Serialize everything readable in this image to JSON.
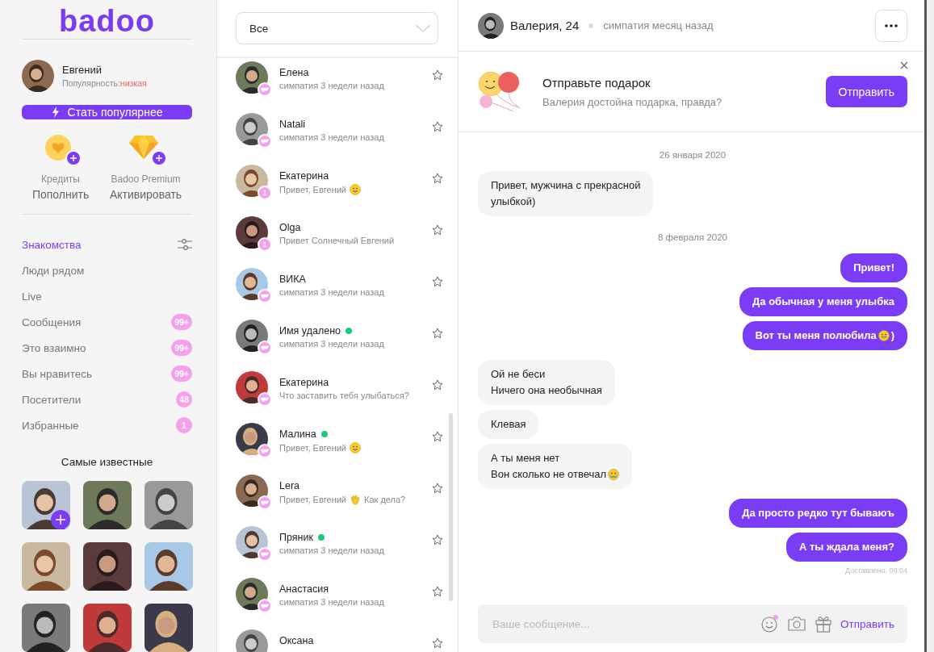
{
  "logo": "badoo",
  "profile": {
    "name": "Евгений",
    "popularity_label": "Популярность:",
    "popularity_value": "низкая"
  },
  "boost_button": "Стать популярнее",
  "perks": [
    {
      "kind": "credits",
      "title": "Кредиты",
      "action": "Пополнить"
    },
    {
      "kind": "premium",
      "title": "Badoo Premium",
      "action": "Активировать"
    }
  ],
  "nav": [
    {
      "label": "Знакомства",
      "selected": true,
      "filter": true
    },
    {
      "label": "Люди рядом",
      "selected": false,
      "filter": false
    },
    {
      "label": "Live",
      "selected": false,
      "filter": false
    },
    {
      "label": "Сообщения",
      "selected": false,
      "filter": false,
      "badge": "99+"
    },
    {
      "label": "Это взаимно",
      "selected": false,
      "filter": false,
      "badge": "99+"
    },
    {
      "label": "Вы нравитесь",
      "selected": false,
      "filter": false,
      "badge": "99+"
    },
    {
      "label": "Посетители",
      "selected": false,
      "filter": false,
      "badge": "48"
    },
    {
      "label": "Избранные",
      "selected": false,
      "filter": false,
      "badge": "1"
    }
  ],
  "popular": {
    "title": "Самые известные",
    "tiles": [
      {
        "kind": "picture",
        "add": true
      },
      {
        "kind": "picture",
        "add": false
      },
      {
        "kind": "picture",
        "add": false
      },
      {
        "kind": "picture",
        "add": false
      },
      {
        "kind": "picture",
        "add": false
      },
      {
        "kind": "picture",
        "add": false
      },
      {
        "kind": "picture",
        "add": false
      },
      {
        "kind": "picture",
        "add": false
      },
      {
        "kind": "picture",
        "add": false
      }
    ]
  },
  "filter_select": {
    "value": "Все"
  },
  "conversations": [
    {
      "name": "Елена",
      "preview": "симпатия 3 недели назад",
      "badge": {
        "kind": "like"
      },
      "online": false
    },
    {
      "name": "Natali",
      "preview": "симпатия 3 недели назад",
      "badge": {
        "kind": "like"
      },
      "online": false
    },
    {
      "name": "Екатерина",
      "preview": "Привет, Евгений",
      "emoji": {
        "kind": "smile"
      },
      "badge": {
        "kind": "count",
        "text": "1"
      },
      "online": false
    },
    {
      "name": "Olga",
      "preview": "Привет Солнечный Евгений",
      "badge": {
        "kind": "count",
        "text": "1"
      },
      "online": false
    },
    {
      "name": "ВИКА",
      "preview": "симпатия 3 недели назад",
      "badge": {
        "kind": "like"
      },
      "online": false
    },
    {
      "name": "Имя удалено",
      "preview": "симпатия 3 недели назад",
      "badge": {
        "kind": "like"
      },
      "online": true
    },
    {
      "name": "Екатерина",
      "preview": "Что заставить тебя улыбаться?",
      "badge": {
        "kind": "like"
      },
      "online": false
    },
    {
      "name": "Малина",
      "preview": "Привет, Евгений",
      "emoji": {
        "kind": "smile"
      },
      "badge": {
        "kind": "like"
      },
      "online": true
    },
    {
      "name": "Lera",
      "preview": "Привет, Евгений",
      "emoji": {
        "kind": "wave"
      },
      "tail": "Как дела?",
      "badge": {
        "kind": "like"
      },
      "online": false
    },
    {
      "name": "Пряник",
      "preview": "симпатия 3 недели назад",
      "badge": {
        "kind": "like"
      },
      "online": true
    },
    {
      "name": "Анастасия",
      "preview": "симпатия 3 недели назад",
      "badge": {
        "kind": "like"
      },
      "online": false
    },
    {
      "name": "Оксана",
      "online": false
    }
  ],
  "chat": {
    "header": {
      "name": "Валерия, 24",
      "status": "симпатия месяц назад"
    },
    "gift": {
      "title": "Отправьте подарок",
      "subtitle": "Валерия достойна подарка, правда?",
      "button": "Отправить"
    },
    "messages": [
      {
        "kind": "date",
        "text": "26 января 2020"
      },
      {
        "kind": "in",
        "lines": [
          "Привет, мужчина с прекрасной",
          "улыбкой)"
        ]
      },
      {
        "kind": "date",
        "text": "8 февраля 2020"
      },
      {
        "kind": "out",
        "lines": [
          "Привет!"
        ]
      },
      {
        "kind": "out",
        "lines": [
          "Да обычная у меня улыбка"
        ]
      },
      {
        "kind": "out",
        "lines": [
          "Вот ты меня полюбила"
        ],
        "emoji": {
          "kind": "grin"
        },
        "tail": ")"
      },
      {
        "kind": "in",
        "lines": [
          "Ой не беси",
          "Ничего она необычная"
        ]
      },
      {
        "kind": "in",
        "lines": [
          "Клевая"
        ]
      },
      {
        "kind": "in",
        "lines": [
          "А ты меня нет",
          "Вон сколько не отвечал"
        ],
        "emoji": {
          "kind": "cry"
        }
      },
      {
        "kind": "out",
        "lines": [
          "Да просто редко тут бываюъ"
        ]
      },
      {
        "kind": "out",
        "lines": [
          "А ты ждала меня?"
        ]
      }
    ],
    "delivered": "Доставлено, 00:04",
    "composer": {
      "placeholder": "Ваше сообщение...",
      "send": "Отправить"
    }
  }
}
